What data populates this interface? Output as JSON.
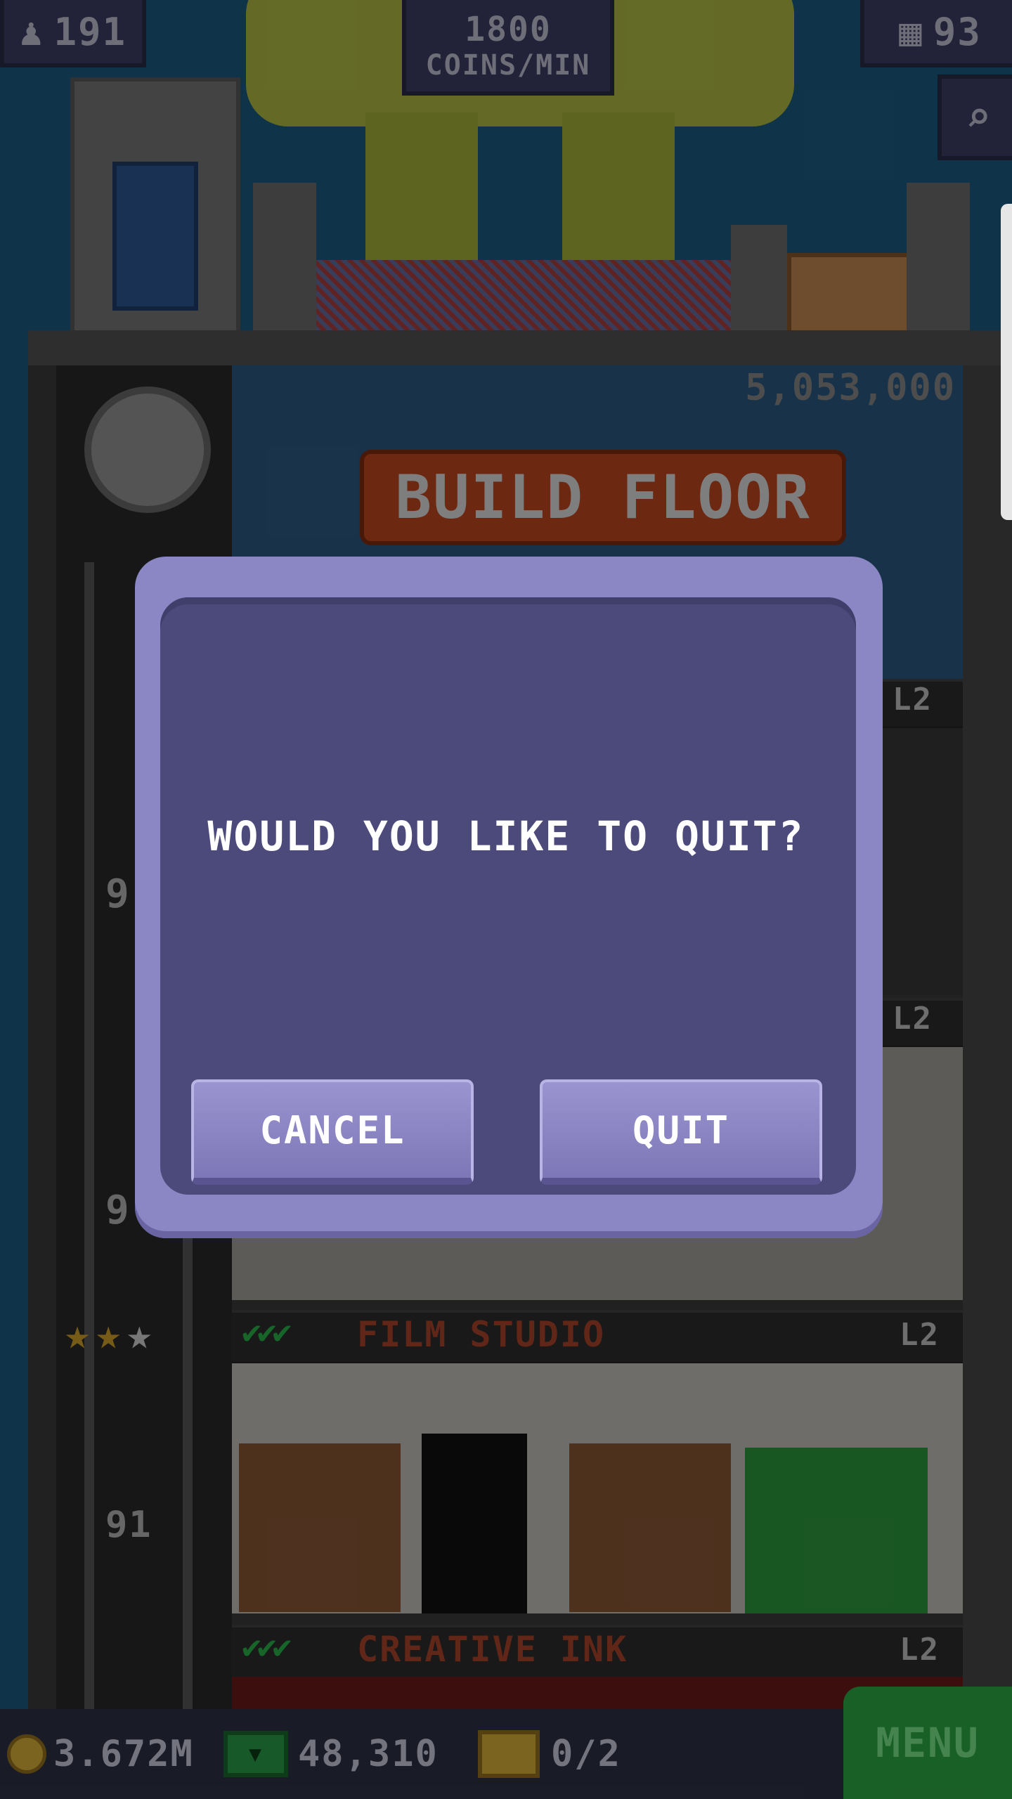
{
  "hud": {
    "population": "191",
    "coins_per_min_value": "1800",
    "coins_per_min_unit": "COINS/MIN",
    "floor_count": "93"
  },
  "tower": {
    "build_cost": "5,053,000",
    "build_floor_label": "BUILD FLOOR",
    "floors": [
      {
        "name": "FILM STUDIO",
        "level": "L2",
        "stars": 2,
        "max_stars": 3
      },
      {
        "name": "CREATIVE INK",
        "level": "L2"
      }
    ],
    "hidden_floor_levels": [
      "L2",
      "L2"
    ],
    "elevator_floor_numbers": [
      "9",
      "9",
      "91"
    ]
  },
  "bottom_bar": {
    "coins": "3.672M",
    "bux": "48,310",
    "chests": "0/2",
    "menu_label": "MENU"
  },
  "dialog": {
    "message": "WOULD YOU LIKE TO QUIT?",
    "cancel_label": "CANCEL",
    "quit_label": "QUIT"
  },
  "colors": {
    "dialog_frame": "#8b86c4",
    "dialog_panel": "#4c4a7b",
    "build_button": "#c64a22",
    "menu_button": "#2faf45",
    "floor_title": "#b0452a"
  }
}
